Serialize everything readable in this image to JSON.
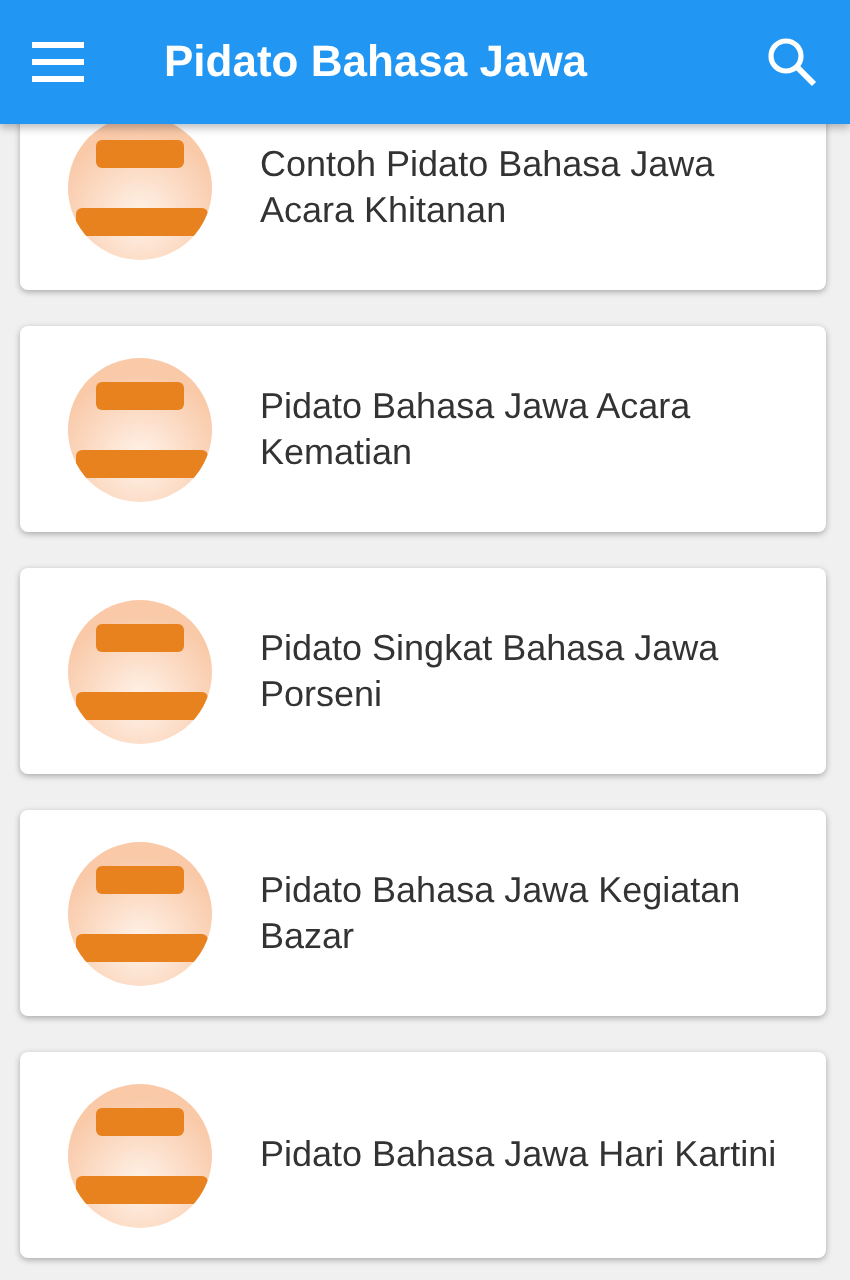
{
  "app_bar": {
    "title": "Pidato Bahasa Jawa"
  },
  "items": [
    {
      "title": "Contoh Pidato Bahasa Jawa Acara Khitanan"
    },
    {
      "title": "Pidato Bahasa Jawa Acara Kematian"
    },
    {
      "title": "Pidato Singkat Bahasa Jawa Porseni"
    },
    {
      "title": "Pidato Bahasa Jawa Kegiatan Bazar"
    },
    {
      "title": "Pidato Bahasa Jawa Hari Kartini"
    }
  ]
}
